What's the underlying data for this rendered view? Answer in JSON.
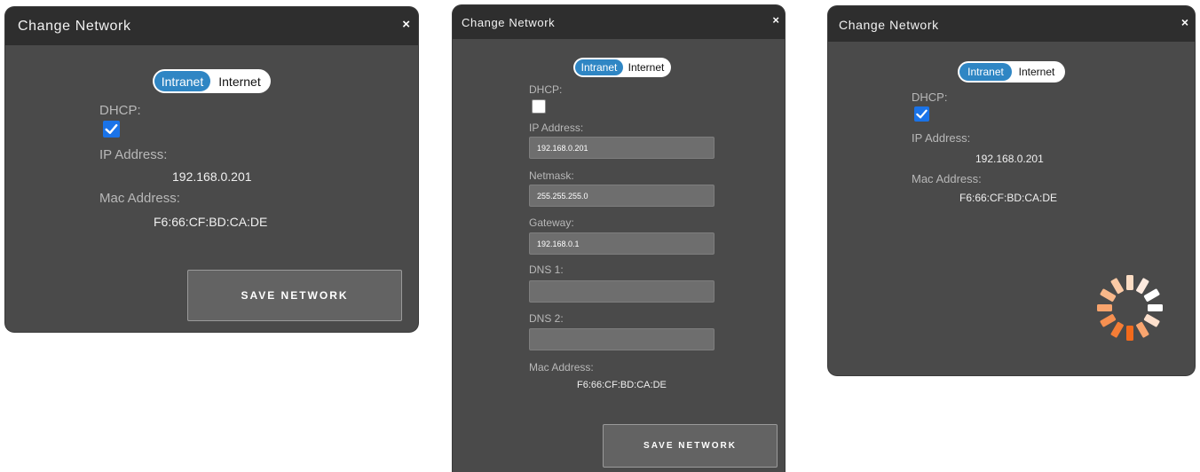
{
  "dialogs": [
    {
      "title": "Change Network",
      "close": "×",
      "toggle": {
        "intranet": "Intranet",
        "internet": "Internet"
      },
      "dhcp_label": "DHCP:",
      "ip_label": "IP Address:",
      "ip_value": "192.168.0.201",
      "mac_label": "Mac Address:",
      "mac_value": "F6:66:CF:BD:CA:DE",
      "save_label": "SAVE NETWORK"
    },
    {
      "title": "Change Network",
      "close": "×",
      "toggle": {
        "intranet": "Intranet",
        "internet": "Internet"
      },
      "dhcp_label": "DHCP:",
      "ip_label": "IP Address:",
      "ip_value": "192.168.0.201",
      "netmask_label": "Netmask:",
      "netmask_value": "255.255.255.0",
      "gateway_label": "Gateway:",
      "gateway_value": "192.168.0.1",
      "dns1_label": "DNS 1:",
      "dns1_value": "",
      "dns2_label": "DNS 2:",
      "dns2_value": "",
      "mac_label": "Mac Address:",
      "mac_value": "F6:66:CF:BD:CA:DE",
      "save_label": "SAVE NETWORK"
    },
    {
      "title": "Change Network",
      "close": "×",
      "toggle": {
        "intranet": "Intranet",
        "internet": "Internet"
      },
      "dhcp_label": "DHCP:",
      "ip_label": "IP Address:",
      "ip_value": "192.168.0.201",
      "mac_label": "Mac Address:",
      "mac_value": "F6:66:CF:BD:CA:DE"
    }
  ],
  "colors": {
    "dialog_bg": "#4a4a4a",
    "header_bg": "#2e2e2e",
    "toggle_active": "#2f86c4",
    "checkbox": "#1a73e8",
    "spinner_accent": "#f26a1b"
  },
  "icons": [
    "close-icon",
    "checkmark-icon",
    "loading-spinner-icon"
  ]
}
